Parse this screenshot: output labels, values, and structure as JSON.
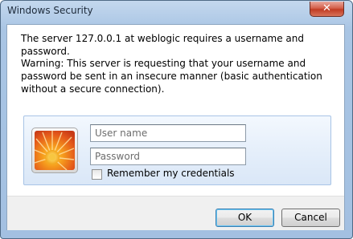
{
  "window": {
    "title": "Windows Security",
    "close_glyph": "✕",
    "icon_close": "close-icon"
  },
  "dialog": {
    "message": "The server 127.0.0.1 at weblogic requires a username and password.",
    "warning": "Warning: This server is requesting that your username and password be sent in an insecure manner (basic authentication without a secure connection)."
  },
  "credentials": {
    "user_icon": "user-tile-flower-icon",
    "username_placeholder": "User name",
    "password_placeholder": "Password",
    "remember_label": "Remember my credentials",
    "remember_checked": false
  },
  "buttons": {
    "ok_label": "OK",
    "cancel_label": "Cancel"
  },
  "colors": {
    "frame": "#a9c5e4",
    "close_button": "#c13c24",
    "credential_panel": "#e4eefa",
    "default_button_border": "#3c7fb1"
  }
}
